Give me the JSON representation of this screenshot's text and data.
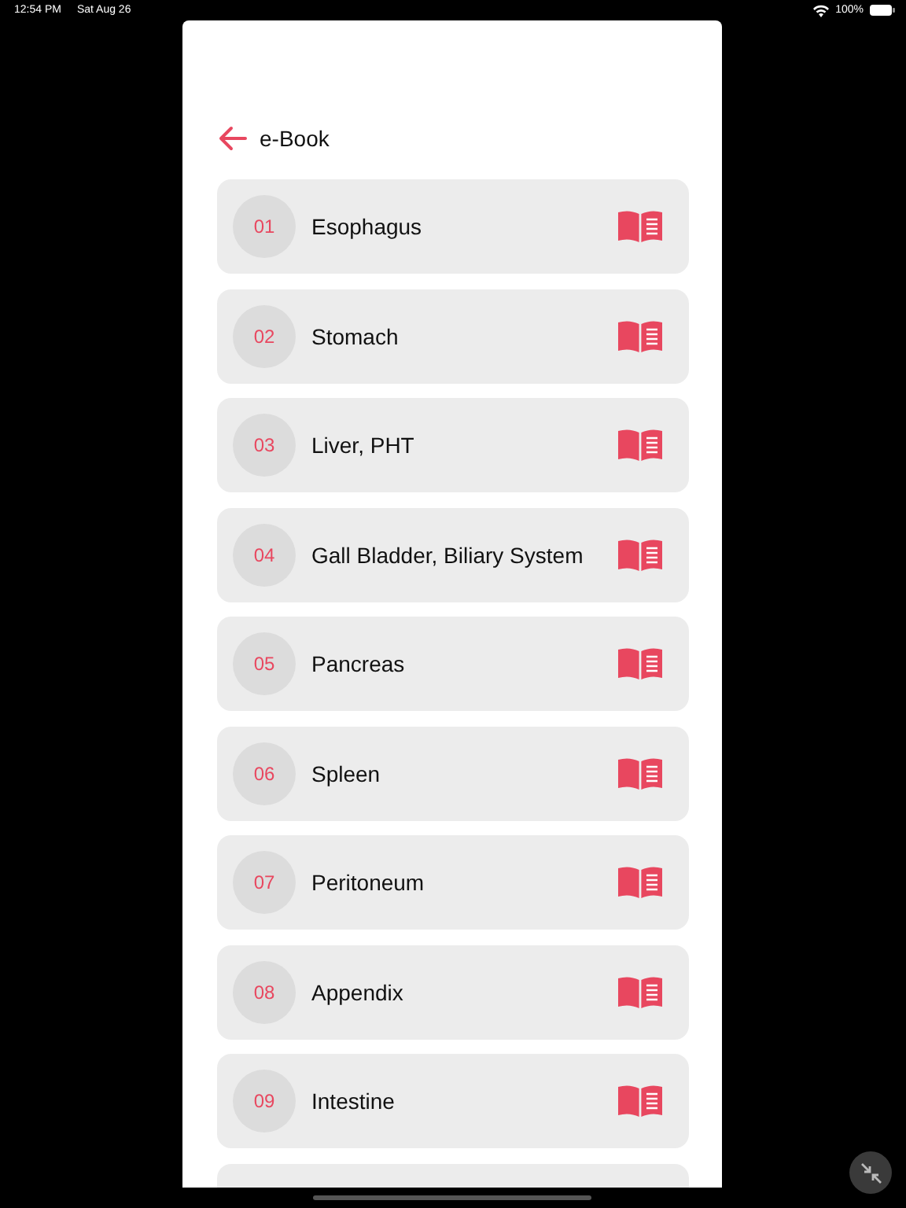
{
  "status_bar": {
    "time": "12:54 PM",
    "date": "Sat Aug 26",
    "battery": "100%"
  },
  "header": {
    "title": "e-Book"
  },
  "chapters": [
    {
      "number": "01",
      "title": "Esophagus"
    },
    {
      "number": "02",
      "title": "Stomach"
    },
    {
      "number": "03",
      "title": "Liver, PHT"
    },
    {
      "number": "04",
      "title": "Gall Bladder, Biliary System"
    },
    {
      "number": "05",
      "title": "Pancreas"
    },
    {
      "number": "06",
      "title": "Spleen"
    },
    {
      "number": "07",
      "title": "Peritoneum"
    },
    {
      "number": "08",
      "title": "Appendix"
    },
    {
      "number": "09",
      "title": "Intestine"
    }
  ]
}
